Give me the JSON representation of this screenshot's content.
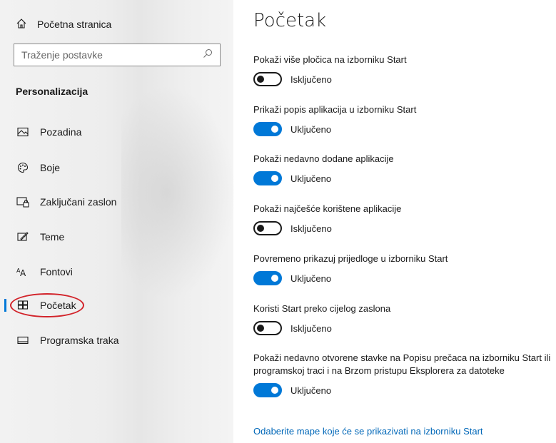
{
  "sidebar": {
    "home_label": "Početna stranica",
    "home_icon": "home-icon",
    "search": {
      "placeholder": "Traženje postavke",
      "value": "",
      "icon": "search-icon"
    },
    "section_title": "Personalizacija",
    "items": [
      {
        "label": "Pozadina",
        "icon": "picture-icon"
      },
      {
        "label": "Boje",
        "icon": "palette-icon"
      },
      {
        "label": "Zaključani zaslon",
        "icon": "lock-screen-icon"
      },
      {
        "label": "Teme",
        "icon": "themes-icon"
      },
      {
        "label": "Fontovi",
        "icon": "fonts-icon"
      },
      {
        "label": "Početak",
        "icon": "start-icon",
        "active": true
      },
      {
        "label": "Programska traka",
        "icon": "taskbar-icon"
      }
    ]
  },
  "main": {
    "title": "Početak",
    "settings": [
      {
        "label": "Pokaži više pločica na izborniku Start",
        "state": "Isključeno",
        "on": false
      },
      {
        "label": "Prikaži popis aplikacija u izborniku Start",
        "state": "Uključeno",
        "on": true
      },
      {
        "label": "Pokaži nedavno dodane aplikacije",
        "state": "Uključeno",
        "on": true
      },
      {
        "label": "Pokaži najčešće korištene aplikacije",
        "state": "Isključeno",
        "on": false
      },
      {
        "label": "Povremeno prikazuj prijedloge u izborniku Start",
        "state": "Uključeno",
        "on": true
      },
      {
        "label": "Koristi Start preko cijelog zaslona",
        "state": "Isključeno",
        "on": false
      },
      {
        "label": "Pokaži nedavno otvorene stavke na Popisu prečaca na izborniku Start ili programskoj traci i na Brzom pristupu Eksplorera za datoteke",
        "state": "Uključeno",
        "on": true
      }
    ],
    "link": "Odaberite mape koje će se prikazivati na izborniku Start"
  },
  "colors": {
    "accent": "#0078d7",
    "link": "#0067b8",
    "highlight": "#d2232a"
  }
}
